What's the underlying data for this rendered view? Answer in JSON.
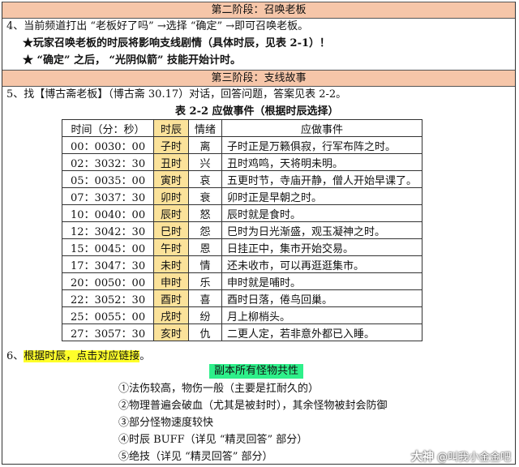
{
  "stage2": {
    "header": "第二阶段：召唤老板",
    "line4": "4、当前频道打出 “老板好了吗” →选择 “确定” →即可召唤老板。",
    "note1": "★玩家召唤老板的时辰将影响支线剧情（具体时辰，见表 2-1）！",
    "note2": "★ “确定” 之后， “光阴似箭” 技能开始计时。"
  },
  "stage3": {
    "header": "第三阶段：支线故事",
    "line5": "5、找【博古斋老板】（博古斋 30.17）对话，回答问题，答案见表 2-2。",
    "table_caption": "表 2-2  应做事件（根据时辰选择）",
    "table_headers": [
      "时间（分：秒）",
      "时辰",
      "情绪",
      "应做事件"
    ],
    "rows": [
      {
        "start": "00：00",
        "end": "30：00",
        "shichen": "子时",
        "mood": "离",
        "event": "子时正是万籁俱寂，行军布阵之时。"
      },
      {
        "start": "02：30",
        "end": "32：30",
        "shichen": "丑时",
        "mood": "兴",
        "event": "丑时鸡鸣，天将明未明。"
      },
      {
        "start": "05：00",
        "end": "35：00",
        "shichen": "寅时",
        "mood": "哀",
        "event": "五更时节，寺庙开静，僧人开始早课了。"
      },
      {
        "start": "07：30",
        "end": "37：30",
        "shichen": "卯时",
        "mood": "衰",
        "event": "卯时正是早朝之时。"
      },
      {
        "start": "10：00",
        "end": "40：00",
        "shichen": "辰时",
        "mood": "怒",
        "event": "辰时就是食时。"
      },
      {
        "start": "12：30",
        "end": "42：30",
        "shichen": "巳时",
        "mood": "怨",
        "event": "巳时为日光渐盛，观玉凝神之时。"
      },
      {
        "start": "15：00",
        "end": "45：00",
        "shichen": "午时",
        "mood": "恩",
        "event": "日挂正中，集市开始交易。"
      },
      {
        "start": "17：30",
        "end": "47：30",
        "shichen": "未时",
        "mood": "情",
        "event": "还未收市，可以再逛逛集市。"
      },
      {
        "start": "20：00",
        "end": "50：00",
        "shichen": "申时",
        "mood": "乐",
        "event": "申时就是哺时。"
      },
      {
        "start": "22：30",
        "end": "52：30",
        "shichen": "酉时",
        "mood": "喜",
        "event": "酉时日落，倦鸟回巢。"
      },
      {
        "start": "25：00",
        "end": "55：00",
        "shichen": "戌时",
        "mood": "纷",
        "event": "月上柳梢头。"
      },
      {
        "start": "27：30",
        "end": "57：30",
        "shichen": "亥时",
        "mood": "仇",
        "event": "二更人定，若非意外都已入睡。"
      }
    ],
    "line6_prefix": "6、",
    "line6_link": "根据时辰，点击对应链接",
    "line6_suffix": "。"
  },
  "boss_traits": {
    "title": "副本所有怪物共性",
    "items": [
      "①法伤较高，物伤一般（主要是扛耐久的）",
      "②物理普遍会破血（尤其是被封时），其余怪物被封会防御",
      "③部分怪物速度较快",
      "④时辰 BUFF（详见 “精灵回答” 部分）",
      "⑤绝技（详见 “精灵回答” 部分）"
    ]
  },
  "watermark": {
    "brand": "大神",
    "handle": "@叫我小金金吧"
  },
  "colors": {
    "header_bg": "#f6c6a9",
    "shichen_bg": "#fbe29a",
    "link_highlight": "#ffff2a",
    "traits_title_bg": "#2ef08a"
  }
}
